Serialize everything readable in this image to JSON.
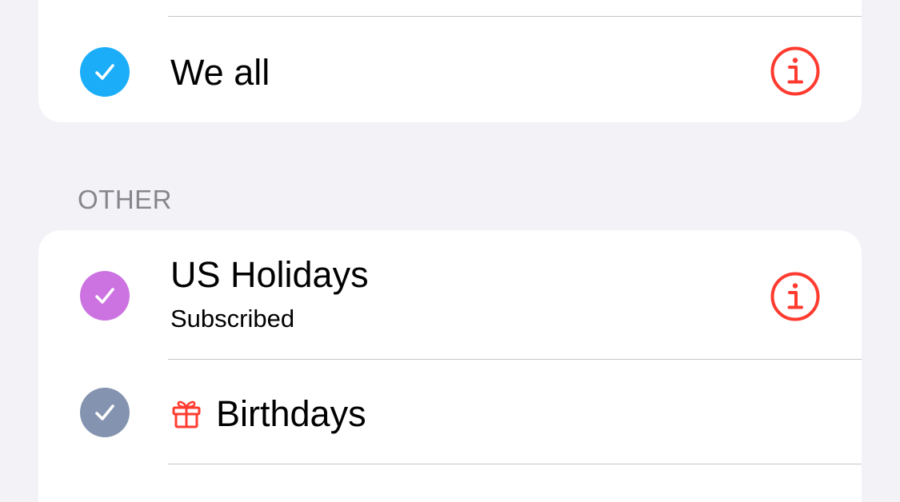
{
  "colors": {
    "background": "#f2f2f7",
    "card": "#ffffff",
    "separator": "#c6c6c8",
    "section_header": "#86868b",
    "info_accent": "#ff3b30",
    "check_we_all": "#1badf8",
    "check_us_holidays": "#cc73e1",
    "check_birthdays": "#8494b0",
    "gift_icon": "#ff3b30"
  },
  "calendars": {
    "we_all": {
      "name": "We all",
      "checked": true,
      "icon": "checkmark-icon",
      "info_icon": "info-circle-icon"
    }
  },
  "sections": {
    "other": {
      "header": "OTHER",
      "items": [
        {
          "name": "US Holidays",
          "subtitle": "Subscribed",
          "checked": true,
          "icon": "checkmark-icon",
          "info_icon": "info-circle-icon"
        },
        {
          "name": "Birthdays",
          "checked": true,
          "icon": "checkmark-icon",
          "leading_icon": "gift-icon"
        }
      ]
    }
  }
}
